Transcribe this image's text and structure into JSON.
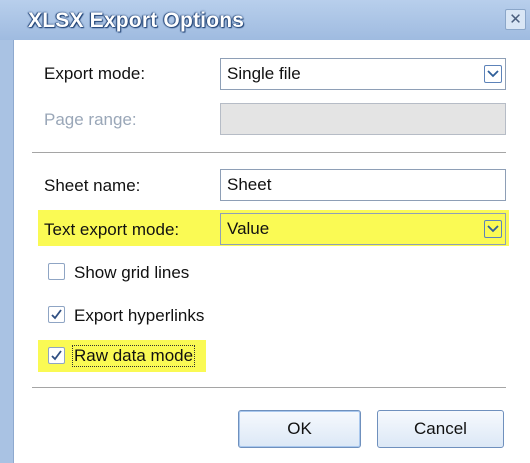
{
  "dialog": {
    "title": "XLSX Export Options",
    "close_glyph": "✕"
  },
  "export_mode": {
    "label": "Export mode:",
    "value": "Single file"
  },
  "page_range": {
    "label": "Page range:",
    "value": ""
  },
  "sheet_name": {
    "label": "Sheet name:",
    "value": "Sheet"
  },
  "text_export_mode": {
    "label": "Text export mode:",
    "value": "Value"
  },
  "options": {
    "show_grid_lines": {
      "label": "Show grid lines",
      "checked": false
    },
    "export_hyperlinks": {
      "label": "Export hyperlinks",
      "checked": true
    },
    "raw_data_mode": {
      "label": "Raw data mode",
      "checked": true
    }
  },
  "buttons": {
    "ok": "OK",
    "cancel": "Cancel"
  },
  "colors": {
    "title_bar": "#a9c2e3",
    "highlight": "#fafa54",
    "accent": "#2f5f9a"
  },
  "icons": [
    "close-icon",
    "chevron-down-icon",
    "checkmark-icon"
  ]
}
